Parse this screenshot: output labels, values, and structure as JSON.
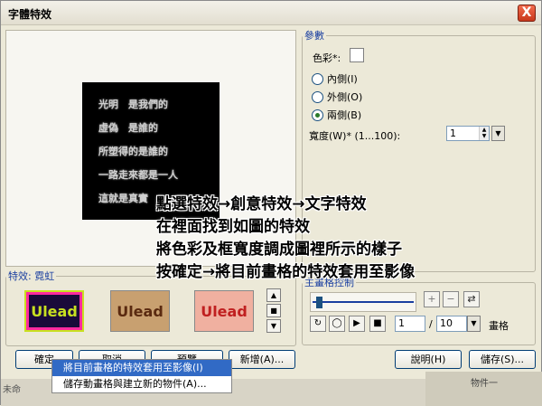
{
  "window": {
    "title": "字體特效",
    "close_label": "X"
  },
  "preview": {
    "lines": [
      "光明　是我們的",
      "虛偽　是誰的",
      "所塑得的是誰的",
      "一路走來都是一人",
      "這就是真實"
    ]
  },
  "params": {
    "legend": "參數",
    "color_label": "色彩*:",
    "radios": [
      {
        "label": "內側(I)",
        "checked": false
      },
      {
        "label": "外側(O)",
        "checked": false
      },
      {
        "label": "兩側(B)",
        "checked": true
      }
    ],
    "width_label": "寬度(W)* (1...100):",
    "width_value": "1"
  },
  "effects": {
    "legend": "特效: 霓虹",
    "thumbnails": [
      "Ulead",
      "Ulead",
      "Ulead"
    ]
  },
  "master": {
    "legend": "主畫格控制",
    "current_frame": "1",
    "separator": "/",
    "total_frames": "10",
    "frames_label": "畫格"
  },
  "buttons": {
    "ok": "確定",
    "cancel": "取消",
    "preview": "預覽",
    "add": "新增(A)...",
    "help": "說明(H)",
    "save": "儲存(S)..."
  },
  "menu": {
    "items": [
      "將目前畫格的特效套用至影像(I)",
      "儲存動畫格與建立新的物件(A)..."
    ]
  },
  "background": {
    "tab": "未命",
    "right_text": "物件一"
  },
  "annotation": {
    "lines": [
      "點選特效→創意特效→文字特效",
      "在裡面找到如圖的特效",
      "將色彩及框寬度調成圖裡所示的樣子",
      "按確定→將目前畫格的特效套用至影像"
    ]
  }
}
